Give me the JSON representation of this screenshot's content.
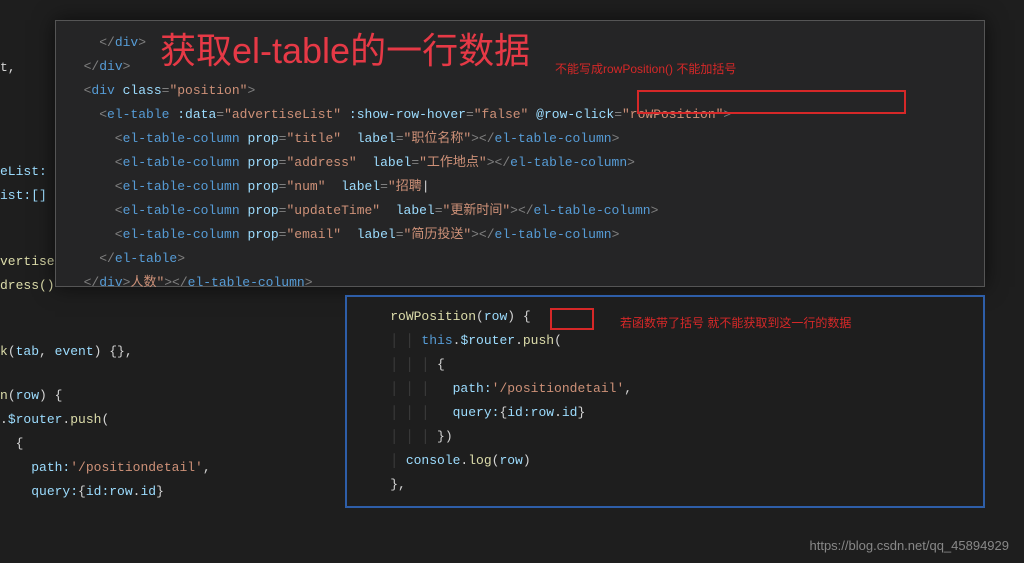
{
  "title": "获取el-table的一行数据",
  "note1": "不能写成rowPosition()  不能加括号",
  "note2": "若函数带了括号  就不能获取到这一行的数据",
  "watermark": "https://blog.csdn.net/qq_45894929",
  "top_code": {
    "l1": "    </div>",
    "l2": "  </div>",
    "l3_a": "  <div ",
    "l3_b": "class",
    "l3_c": "=",
    "l3_d": "\"position\"",
    "l3_e": ">",
    "l4_a": "    <el-table ",
    "l4_b": ":data",
    "l4_c": "=",
    "l4_d": "\"advertiseList\"",
    "l4_e": " :show-row-hover",
    "l4_f": "=",
    "l4_g": "\"false\"",
    "l4_h": " @row-click",
    "l4_i": "=",
    "l4_j": "\"roWPosition\"",
    "l4_k": ">",
    "l5_a": "      <el-table-column ",
    "l5_b": "prop",
    "l5_c": "=",
    "l5_d": "\"title\"",
    "l5_e": "  label",
    "l5_f": "=",
    "l5_g": "\"职位名称\"",
    "l5_h": "></el-table-column>",
    "l6_a": "      <el-table-column ",
    "l6_b": "prop",
    "l6_c": "=",
    "l6_d": "\"address\"",
    "l6_e": "  label",
    "l6_f": "=",
    "l6_g": "\"工作地点\"",
    "l6_h": "></el-table-column>",
    "l7_a": "      <el-table-column ",
    "l7_b": "prop",
    "l7_c": "=",
    "l7_d": "\"num\"",
    "l7_e": "  label",
    "l7_f": "=",
    "l7_g": "\"招聘",
    "l8_a": "      <el-table-column ",
    "l8_b": "prop",
    "l8_c": "=",
    "l8_d": "\"updateTime\"",
    "l8_e": "  label",
    "l8_f": "=",
    "l8_g": "\"更新时间\"",
    "l8_h": "></el-table-column>",
    "l9_a": "      <el-table-column ",
    "l9_b": "prop",
    "l9_c": "=",
    "l9_d": "\"email\"",
    "l9_e": "  label",
    "l9_f": "=",
    "l9_g": "\"简历投送\"",
    "l9_h": "></el-table-column>",
    "l10": "    </el-table>",
    "l11_a": "  </div>",
    "l11_b": "人数\"",
    "l11_c": "></el-table-column>"
  },
  "bottom_code": {
    "l1_a": "roWPosition",
    "l1_b": "(",
    "l1_c": "row",
    "l1_d": ") {",
    "l2_a": "      ",
    "l2_b": "this",
    "l2_c": ".",
    "l2_d": "$router",
    "l2_e": ".",
    "l2_f": "push",
    "l2_g": "(",
    "l3": "          {",
    "l4_a": "              ",
    "l4_b": "path:",
    "l4_c": "'/positiondetail'",
    "l4_d": ",",
    "l5_a": "              ",
    "l5_b": "query:",
    "l5_c": "{",
    "l5_d": "id:",
    "l5_e": "row",
    "l5_f": ".",
    "l5_g": "id",
    "l5_h": "}",
    "l6": "          })",
    "l7_a": "      ",
    "l7_b": "console",
    "l7_c": ".",
    "l7_d": "log",
    "l7_e": "(",
    "l7_f": "row",
    "l7_g": ")",
    "l8": "  },"
  },
  "left": {
    "l1": "t,",
    "l2": "eList:",
    "l3": "ist:[]",
    "l4": "vertiseList()",
    "l5": "dress()",
    "l6": "k(tab, event) {},",
    "l7": "n(row) {",
    "l8": ".$router.push(",
    "l9": "  {",
    "l10": "    path:'/positiondetail',",
    "l11": "    query:{id:row.id}"
  }
}
